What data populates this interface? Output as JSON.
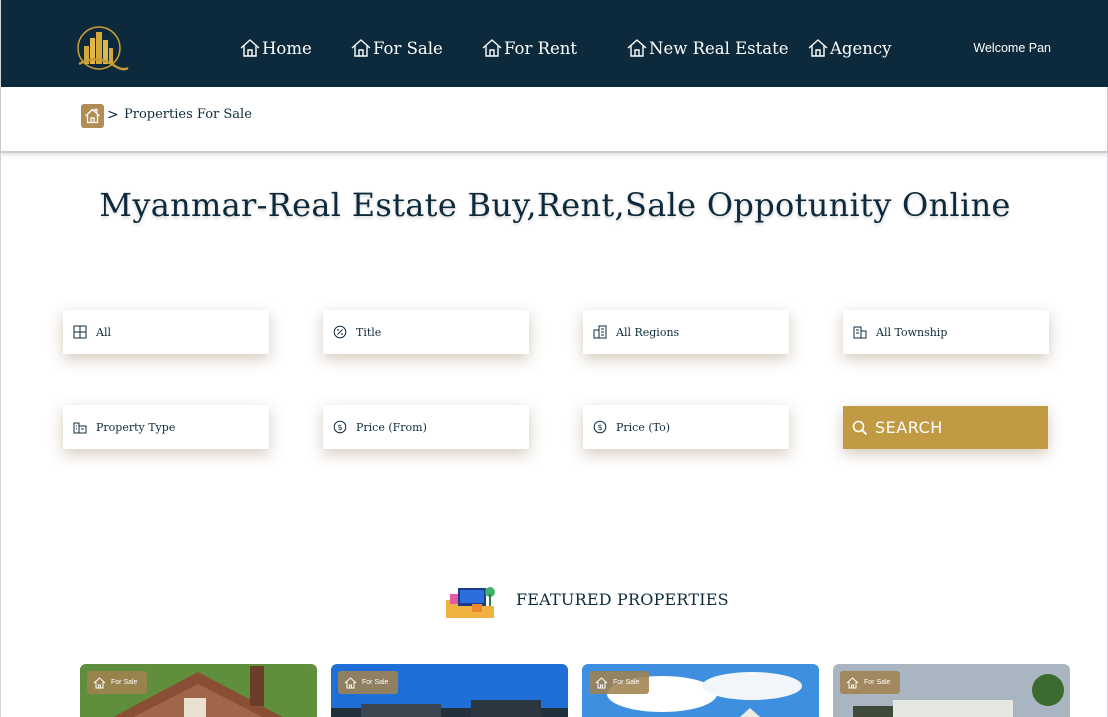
{
  "header": {
    "nav": [
      {
        "label": "Home",
        "icon": "home-icon"
      },
      {
        "label": "For Sale",
        "icon": "home-icon"
      },
      {
        "label": "For Rent",
        "icon": "home-icon"
      },
      {
        "label": "New Real Estate",
        "icon": "home-icon"
      },
      {
        "label": "Agency",
        "icon": "home-icon"
      }
    ],
    "welcome": "Welcome Pan"
  },
  "breadcrumb": {
    "separator": ">",
    "current": "Properties For Sale"
  },
  "headline": "Myanmar-Real Estate Buy,Rent,Sale Oppotunity Online",
  "filters": {
    "category": "All",
    "title": "Title",
    "region": "All Regions",
    "township": "All Township",
    "property_type": "Property Type",
    "price_from": "Price (From)",
    "price_to": "Price (To)"
  },
  "search_label": "SEARCH",
  "featured": {
    "title": "FEATURED PROPERTIES",
    "cards": [
      {
        "badge": "For Sale"
      },
      {
        "badge": "For Sale"
      },
      {
        "badge": "For Sale"
      },
      {
        "badge": "For Sale"
      }
    ]
  },
  "colors": {
    "navy": "#0c2a3b",
    "gold": "#c19a44",
    "badge": "#a08250"
  }
}
